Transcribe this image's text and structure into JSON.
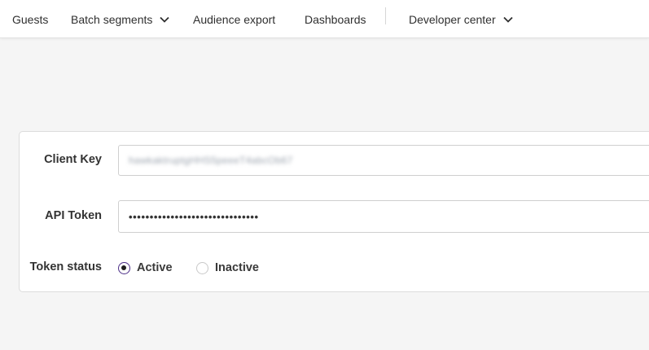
{
  "nav": {
    "items": [
      {
        "label": "Guests",
        "has_dropdown": false
      },
      {
        "label": "Batch segments",
        "has_dropdown": true
      },
      {
        "label": "Audience export",
        "has_dropdown": false
      },
      {
        "label": "Dashboards",
        "has_dropdown": false
      },
      {
        "label": "Developer center",
        "has_dropdown": true
      }
    ]
  },
  "form": {
    "client_key": {
      "label": "Client Key",
      "value": "hawkaktruptgHHS5peeeT4abcOb67"
    },
    "api_token": {
      "label": "API Token",
      "value": "•••••••••••••••••••••••••••••••"
    },
    "token_status": {
      "label": "Token status",
      "options": [
        {
          "label": "Active",
          "checked": true
        },
        {
          "label": "Inactive",
          "checked": false
        }
      ]
    }
  },
  "colors": {
    "accent": "#4a2c86",
    "background": "#f5f5f5",
    "card": "#ffffff"
  }
}
